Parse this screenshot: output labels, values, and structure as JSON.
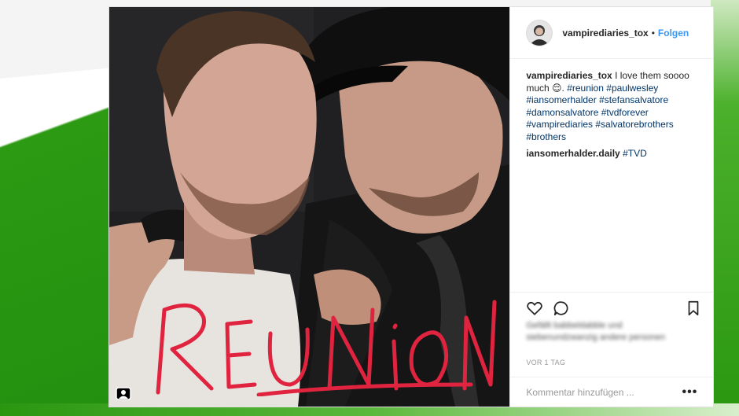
{
  "post": {
    "username": "vampirediaries_tox",
    "separator": "•",
    "follow_label": "Folgen",
    "caption": {
      "username": "vampirediaries_tox",
      "text": "I love them soooo much 😌.",
      "hashtags": [
        "#reunion",
        "#paulwesley",
        "#iansomerhalder",
        "#stefansalvatore",
        "#damonsalvatore",
        "#tvdforever",
        "#vampirediaries",
        "#salvatorebrothers",
        "#brothers"
      ]
    },
    "comment": {
      "username": "iansomerhalder.daily",
      "text": "#TVD"
    },
    "photo_overlay_text": "REUNION",
    "likes_blurred": "Gefällt babbeldabble und siebenundzwanzig andere personen",
    "timestamp": "VOR 1 TAG",
    "comment_placeholder": "Kommentar hinzufügen ...",
    "more_label": "•••"
  },
  "icons": {
    "like": "heart-icon",
    "comment": "comment-icon",
    "save": "bookmark-icon",
    "options": "more-options-icon",
    "tagged": "tagged-user-icon"
  },
  "colors": {
    "link": "#3897f0",
    "hashtag": "#003569",
    "background_green": "#2a9610",
    "overlay_text": "#e0243f"
  }
}
